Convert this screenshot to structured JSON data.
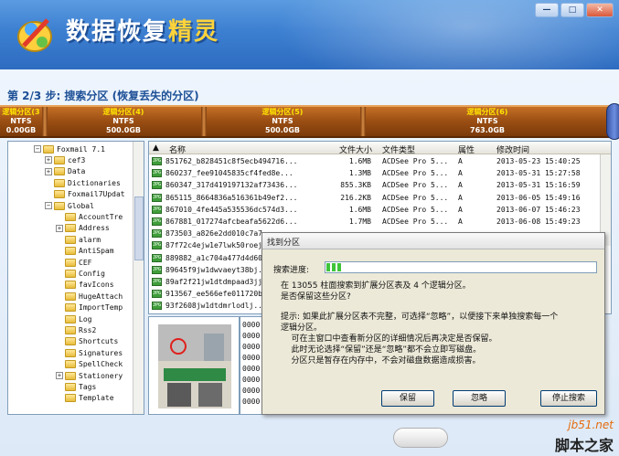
{
  "app": {
    "title_a": "数据恢复",
    "title_b": "精灵"
  },
  "window_buttons": {
    "minimize": "—",
    "maximize": "□",
    "close": "✕"
  },
  "step": {
    "text": "第 2/3 步: 搜索分区 (恢复丢失的分区)"
  },
  "partitions": [
    {
      "name": "逻辑分区(3",
      "fs": "NTFS",
      "size": "0.00GB"
    },
    {
      "name": "逻辑分区(4)",
      "fs": "NTFS",
      "size": "500.0GB"
    },
    {
      "name": "逻辑分区(5)",
      "fs": "NTFS",
      "size": "500.0GB"
    },
    {
      "name": "逻辑分区(6)",
      "fs": "NTFS",
      "size": "763.0GB"
    }
  ],
  "tree": [
    {
      "label": "Foxmail 7.1",
      "indent": 0,
      "toggle": "−"
    },
    {
      "label": "cef3",
      "indent": 1,
      "toggle": "+"
    },
    {
      "label": "Data",
      "indent": 1,
      "toggle": "+"
    },
    {
      "label": "Dictionaries",
      "indent": 1,
      "toggle": ""
    },
    {
      "label": "Foxmail7Updat",
      "indent": 1,
      "toggle": ""
    },
    {
      "label": "Global",
      "indent": 1,
      "toggle": "−"
    },
    {
      "label": "AccountTre",
      "indent": 2,
      "toggle": ""
    },
    {
      "label": "Address",
      "indent": 2,
      "toggle": "+"
    },
    {
      "label": "alarm",
      "indent": 2,
      "toggle": ""
    },
    {
      "label": "AntiSpam",
      "indent": 2,
      "toggle": ""
    },
    {
      "label": "CEF",
      "indent": 2,
      "toggle": ""
    },
    {
      "label": "Config",
      "indent": 2,
      "toggle": ""
    },
    {
      "label": "favIcons",
      "indent": 2,
      "toggle": ""
    },
    {
      "label": "HugeAttach",
      "indent": 2,
      "toggle": ""
    },
    {
      "label": "ImportTemp",
      "indent": 2,
      "toggle": ""
    },
    {
      "label": "Log",
      "indent": 2,
      "toggle": ""
    },
    {
      "label": "Rss2",
      "indent": 2,
      "toggle": ""
    },
    {
      "label": "Shortcuts",
      "indent": 2,
      "toggle": ""
    },
    {
      "label": "Signatures",
      "indent": 2,
      "toggle": ""
    },
    {
      "label": "SpellCheck",
      "indent": 2,
      "toggle": ""
    },
    {
      "label": "Stationery",
      "indent": 2,
      "toggle": "+"
    },
    {
      "label": "Tags",
      "indent": 2,
      "toggle": ""
    },
    {
      "label": "Template",
      "indent": 2,
      "toggle": ""
    }
  ],
  "file_headers": {
    "name": "名称",
    "size": "文件大小",
    "type": "文件类型",
    "attr": "属性",
    "mtime": "修改时间"
  },
  "files": [
    {
      "name": "851762_b828451c8f5ecb494716...",
      "size": "1.6MB",
      "type": "ACDSee Pro 5...",
      "attr": "A",
      "mtime": "2013-05-23 15:40:25"
    },
    {
      "name": "860237_fee91045835cf4fed8e...",
      "size": "1.3MB",
      "type": "ACDSee Pro 5...",
      "attr": "A",
      "mtime": "2013-05-31 15:27:58"
    },
    {
      "name": "860347_317d419197132af73436...",
      "size": "855.3KB",
      "type": "ACDSee Pro 5...",
      "attr": "A",
      "mtime": "2013-05-31 15:16:59"
    },
    {
      "name": "865115_8664836a516361b49ef2...",
      "size": "216.2KB",
      "type": "ACDSee Pro 5...",
      "attr": "A",
      "mtime": "2013-06-05 15:49:16"
    },
    {
      "name": "867010_4fe445a535536dc574d3...",
      "size": "1.6MB",
      "type": "ACDSee Pro 5...",
      "attr": "A",
      "mtime": "2013-06-07 15:46:23"
    },
    {
      "name": "867881_017274afcbeafa5622d6...",
      "size": "1.7MB",
      "type": "ACDSee Pro 5...",
      "attr": "A",
      "mtime": "2013-06-08 15:49:23"
    },
    {
      "name": "873503_a826e2dd010c7a7...",
      "size": "",
      "type": "",
      "attr": "",
      "mtime": ""
    },
    {
      "name": "87f72c4ejw1e7lwk50roej2...",
      "size": "",
      "type": "",
      "attr": "",
      "mtime": ""
    },
    {
      "name": "889882_a1c704a477d4d601...",
      "size": "",
      "type": "",
      "attr": "",
      "mtime": ""
    },
    {
      "name": "89645f9jw1dwvaeyt38bj...",
      "size": "",
      "type": "",
      "attr": "",
      "mtime": ""
    },
    {
      "name": "89af2f21jw1dtdmpaad3jj...",
      "size": "",
      "type": "",
      "attr": "",
      "mtime": ""
    },
    {
      "name": "913567_ee566efe011720b4...",
      "size": "",
      "type": "",
      "attr": "",
      "mtime": ""
    },
    {
      "name": "93f2608jw1dtdmrlodlj...",
      "size": "",
      "type": "",
      "attr": "",
      "mtime": ""
    }
  ],
  "hex": [
    "0000",
    "0000",
    "0000",
    "0000",
    "0000",
    "0000",
    "0000",
    "0000"
  ],
  "dialog": {
    "title": "找到分区",
    "progress_label": "搜索进度:",
    "progress_fraction": 0.04,
    "message": "在 13055 柱面搜索到扩展分区表及 4 个逻辑分区。\n是否保留这些分区?",
    "tip": "提示: 如果此扩展分区表不完整，可选择“忽略”，以便接下来单独搜索每一个\n逻辑分区。\n    可在主窗口中查看新分区的详细情况后再决定是否保留。\n    此时无论选择“保留”还是“忽略”都不会立即写磁盘。\n    分区只是暂存在内存中，不会对磁盘数据造成损害。",
    "btn_keep": "保留",
    "btn_ignore": "忽略",
    "btn_stop": "停止搜索"
  },
  "watermark": {
    "line1": "jb51.net",
    "line2": "脚本之家"
  }
}
